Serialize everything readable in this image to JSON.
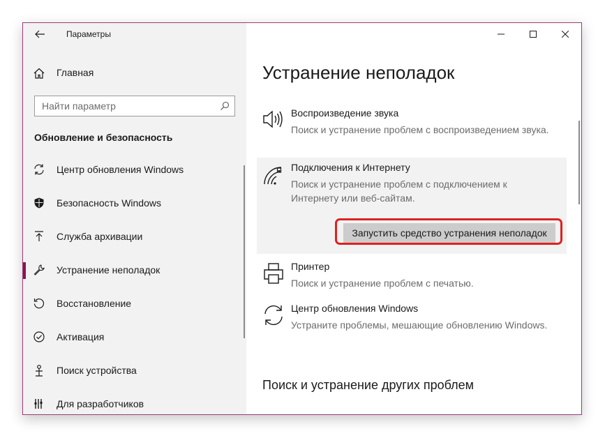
{
  "window": {
    "title": "Параметры",
    "controls": {
      "minimize": "minimize-icon",
      "maximize": "maximize-icon",
      "close": "close-icon"
    }
  },
  "sidebar": {
    "home_label": "Главная",
    "search_placeholder": "Найти параметр",
    "section_title": "Обновление и безопасность",
    "items": [
      {
        "label": "Центр обновления Windows",
        "icon": "sync-icon"
      },
      {
        "label": "Безопасность Windows",
        "icon": "shield-icon"
      },
      {
        "label": "Служба архивации",
        "icon": "backup-arrow-icon"
      },
      {
        "label": "Устранение неполадок",
        "icon": "wrench-icon",
        "active": true
      },
      {
        "label": "Восстановление",
        "icon": "recovery-icon"
      },
      {
        "label": "Активация",
        "icon": "check-circle-icon"
      },
      {
        "label": "Поиск устройства",
        "icon": "find-device-icon"
      },
      {
        "label": "Для разработчиков",
        "icon": "developer-icon"
      }
    ]
  },
  "main": {
    "title": "Устранение неполадок",
    "troubleshooters": [
      {
        "name": "Воспроизведение звука",
        "desc": "Поиск и устранение проблем с воспроизведением звука.",
        "icon": "speaker-icon"
      },
      {
        "name": "Подключения к Интернету",
        "desc": "Поиск и устранение проблем с подключением к Интернету или веб-сайтам.",
        "icon": "network-icon",
        "selected": true
      },
      {
        "name": "Принтер",
        "desc": "Поиск и устранение проблем с печатью.",
        "icon": "printer-icon"
      },
      {
        "name": "Центр обновления Windows",
        "desc": "Устраните проблемы, мешающие обновлению Windows.",
        "icon": "sync-icon"
      }
    ],
    "run_button": "Запустить средство устранения неполадок",
    "other_title": "Поиск и устранение других проблем"
  },
  "colors": {
    "accent": "#87164e",
    "highlight": "#e02020",
    "button_bg": "#cccccc",
    "sidebar_bg": "#f2f2f2"
  }
}
